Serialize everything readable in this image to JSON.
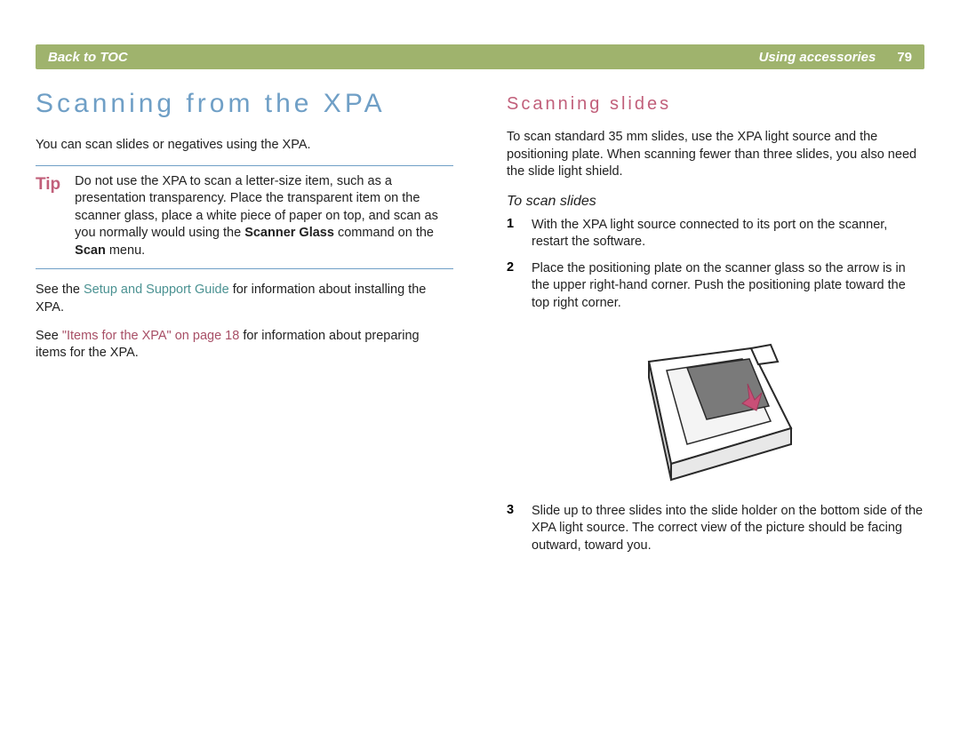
{
  "header": {
    "back": "Back to TOC",
    "section": "Using accessories",
    "page": "79"
  },
  "left": {
    "title": "Scanning from the XPA",
    "intro": "You can scan slides or negatives using the XPA.",
    "tip": {
      "label": "Tip",
      "text_pre": "Do not use the XPA to scan a letter-size item, such as a presentation transparency. Place the transparent item on the scanner glass, place a white piece of paper on top, and scan as you normally would using the ",
      "bold1": "Scanner Glass",
      "text_mid": " command on the ",
      "bold2": "Scan",
      "text_post": " menu."
    },
    "para2_pre": "See the ",
    "para2_link": "Setup and Support Guide",
    "para2_post": " for information about installing the XPA.",
    "para3_pre": "See ",
    "para3_link": "\"Items for the XPA\" on page 18",
    "para3_post": " for information about preparing items for the XPA."
  },
  "right": {
    "title": "Scanning slides",
    "intro": "To scan standard 35 mm slides, use the XPA light source and the positioning plate. When scanning fewer than three slides, you also need the slide light shield.",
    "proc_title": "To scan slides",
    "steps": [
      {
        "num": "1",
        "text": "With the XPA light source connected to its port on the scanner, restart the software."
      },
      {
        "num": "2",
        "text": "Place the positioning plate on the scanner glass so the arrow is in the upper right-hand corner. Push the positioning plate toward the top right corner."
      },
      {
        "num": "3",
        "text": "Slide up to three slides into the slide holder on the bottom side of the XPA light source. The correct view of the picture should be facing outward, toward you."
      }
    ]
  }
}
